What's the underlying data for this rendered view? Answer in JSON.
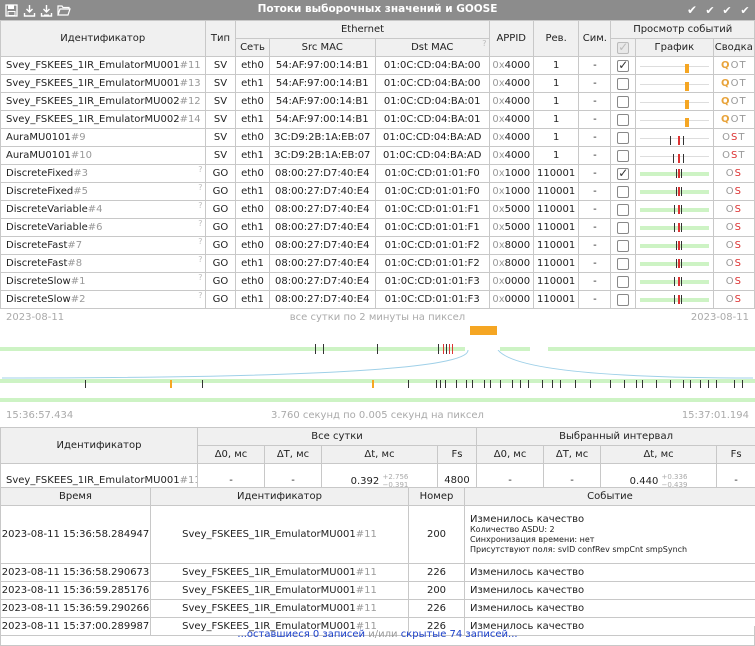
{
  "title": "Потоки выборочных значений и GOOSE",
  "toolbar_icons": [
    "save-icon",
    "download-icon",
    "download-all-icon",
    "folder-open-icon"
  ],
  "header_right_icons": [
    "check-icon",
    "double-check-icon",
    "double-check-all-icon",
    "check-down-icon"
  ],
  "streams": {
    "headers": {
      "id": "Идентификатор",
      "type": "Тип",
      "ethernet": "Ethernet",
      "net": "Сеть",
      "src": "Src MAC",
      "dst": "Dst MAC",
      "appid": "APPID",
      "rev": "Рев.",
      "sim": "Сим.",
      "events": "Просмотр событий",
      "graph": "График",
      "summary": "Сводка"
    },
    "rows": [
      {
        "id": "Svey_FSKEES_1IR_EmulatorMU001",
        "num": "#11",
        "type": "SV",
        "net": "eth0",
        "src": "54:AF:97:00:14:B1",
        "dst": "01:0C:CD:04:BA:00",
        "appid_pre": "0x",
        "appid": "4000",
        "rev": "1",
        "sim": "-",
        "checked": true,
        "sum": [
          "Q",
          "O",
          "T"
        ],
        "sum_colors": [
          "sq",
          "so",
          "st"
        ],
        "track": "none",
        "marks": [
          {
            "p": 0.66,
            "c": "#f5a623",
            "w": 4
          }
        ]
      },
      {
        "id": "Svey_FSKEES_1IR_EmulatorMU001",
        "num": "#13",
        "type": "SV",
        "net": "eth1",
        "src": "54:AF:97:00:14:B1",
        "dst": "01:0C:CD:04:BA:00",
        "appid_pre": "0x",
        "appid": "4000",
        "rev": "1",
        "sim": "-",
        "checked": false,
        "sum": [
          "Q",
          "O",
          "T"
        ],
        "sum_colors": [
          "sq",
          "so",
          "st"
        ],
        "track": "none",
        "marks": [
          {
            "p": 0.66,
            "c": "#f5a623",
            "w": 4
          }
        ]
      },
      {
        "id": "Svey_FSKEES_1IR_EmulatorMU002",
        "num": "#12",
        "type": "SV",
        "net": "eth0",
        "src": "54:AF:97:00:14:B1",
        "dst": "01:0C:CD:04:BA:01",
        "appid_pre": "0x",
        "appid": "4000",
        "rev": "1",
        "sim": "-",
        "checked": false,
        "sum": [
          "Q",
          "O",
          "T"
        ],
        "sum_colors": [
          "sq",
          "so",
          "st"
        ],
        "track": "none",
        "marks": [
          {
            "p": 0.66,
            "c": "#f5a623",
            "w": 4
          }
        ]
      },
      {
        "id": "Svey_FSKEES_1IR_EmulatorMU002",
        "num": "#14",
        "type": "SV",
        "net": "eth1",
        "src": "54:AF:97:00:14:B1",
        "dst": "01:0C:CD:04:BA:01",
        "appid_pre": "0x",
        "appid": "4000",
        "rev": "1",
        "sim": "-",
        "checked": false,
        "sum": [
          "Q",
          "O",
          "T"
        ],
        "sum_colors": [
          "sq",
          "so",
          "st"
        ],
        "track": "none",
        "marks": [
          {
            "p": 0.66,
            "c": "#f5a623",
            "w": 4
          }
        ]
      },
      {
        "id": "AuraMU0101",
        "num": "#9",
        "type": "SV",
        "net": "eth0",
        "src": "3C:D9:2B:1A:EB:07",
        "dst": "01:0C:CD:04:BA:AD",
        "appid_pre": "0x",
        "appid": "4000",
        "rev": "1",
        "sim": "-",
        "checked": false,
        "sum": [
          "O",
          "S",
          "T"
        ],
        "sum_colors": [
          "so",
          "ss",
          "st"
        ],
        "track": "none",
        "marks": [
          {
            "p": 0.44,
            "c": "#333",
            "w": 1
          },
          {
            "p": 0.55,
            "c": "#d33",
            "w": 2
          },
          {
            "p": 0.62,
            "c": "#333",
            "w": 1
          }
        ]
      },
      {
        "id": "AuraMU0101",
        "num": "#10",
        "type": "SV",
        "net": "eth1",
        "src": "3C:D9:2B:1A:EB:07",
        "dst": "01:0C:CD:04:BA:AD",
        "appid_pre": "0x",
        "appid": "4000",
        "rev": "1",
        "sim": "-",
        "checked": false,
        "sum": [
          "O",
          "S",
          "T"
        ],
        "sum_colors": [
          "so",
          "ss",
          "st"
        ],
        "track": "none",
        "marks": [
          {
            "p": 0.48,
            "c": "#333",
            "w": 1
          },
          {
            "p": 0.55,
            "c": "#d33",
            "w": 2
          },
          {
            "p": 0.62,
            "c": "#333",
            "w": 1
          }
        ]
      },
      {
        "id": "DiscreteFixed",
        "num": "#3",
        "type": "GO",
        "net": "eth0",
        "src": "08:00:27:D7:40:E4",
        "dst": "01:0C:CD:01:01:F0",
        "appid_pre": "0x",
        "appid": "1000",
        "rev": "110001",
        "sim": "-",
        "checked": true,
        "sum": [
          "O",
          "S"
        ],
        "sum_colors": [
          "so",
          "ss"
        ],
        "track": "green",
        "marks": [
          {
            "p": 0.52,
            "c": "#333",
            "w": 1
          },
          {
            "p": 0.55,
            "c": "#d33",
            "w": 2
          },
          {
            "p": 0.6,
            "c": "#333",
            "w": 1
          }
        ]
      },
      {
        "id": "DiscreteFixed",
        "num": "#5",
        "type": "GO",
        "net": "eth1",
        "src": "08:00:27:D7:40:E4",
        "dst": "01:0C:CD:01:01:F0",
        "appid_pre": "0x",
        "appid": "1000",
        "rev": "110001",
        "sim": "-",
        "checked": false,
        "sum": [
          "O",
          "S"
        ],
        "sum_colors": [
          "so",
          "ss"
        ],
        "track": "green",
        "marks": [
          {
            "p": 0.52,
            "c": "#333",
            "w": 1
          },
          {
            "p": 0.55,
            "c": "#d33",
            "w": 2
          },
          {
            "p": 0.6,
            "c": "#333",
            "w": 1
          }
        ]
      },
      {
        "id": "DiscreteVariable",
        "num": "#4",
        "type": "GO",
        "net": "eth0",
        "src": "08:00:27:D7:40:E4",
        "dst": "01:0C:CD:01:01:F1",
        "appid_pre": "0x",
        "appid": "5000",
        "rev": "110001",
        "sim": "-",
        "checked": false,
        "sum": [
          "O",
          "S"
        ],
        "sum_colors": [
          "so",
          "ss"
        ],
        "track": "green",
        "marks": [
          {
            "p": 0.5,
            "c": "#333",
            "w": 1
          },
          {
            "p": 0.55,
            "c": "#d33",
            "w": 2
          },
          {
            "p": 0.6,
            "c": "#333",
            "w": 1
          }
        ]
      },
      {
        "id": "DiscreteVariable",
        "num": "#6",
        "type": "GO",
        "net": "eth1",
        "src": "08:00:27:D7:40:E4",
        "dst": "01:0C:CD:01:01:F1",
        "appid_pre": "0x",
        "appid": "5000",
        "rev": "110001",
        "sim": "-",
        "checked": false,
        "sum": [
          "O",
          "S"
        ],
        "sum_colors": [
          "so",
          "ss"
        ],
        "track": "green",
        "marks": [
          {
            "p": 0.5,
            "c": "#333",
            "w": 1
          },
          {
            "p": 0.55,
            "c": "#d33",
            "w": 2
          },
          {
            "p": 0.6,
            "c": "#333",
            "w": 1
          }
        ]
      },
      {
        "id": "DiscreteFast",
        "num": "#7",
        "type": "GO",
        "net": "eth0",
        "src": "08:00:27:D7:40:E4",
        "dst": "01:0C:CD:01:01:F2",
        "appid_pre": "0x",
        "appid": "8000",
        "rev": "110001",
        "sim": "-",
        "checked": false,
        "sum": [
          "O",
          "S"
        ],
        "sum_colors": [
          "so",
          "ss"
        ],
        "track": "green",
        "marks": [
          {
            "p": 0.52,
            "c": "#333",
            "w": 1
          },
          {
            "p": 0.55,
            "c": "#d33",
            "w": 2
          },
          {
            "p": 0.6,
            "c": "#333",
            "w": 1
          }
        ]
      },
      {
        "id": "DiscreteFast",
        "num": "#8",
        "type": "GO",
        "net": "eth1",
        "src": "08:00:27:D7:40:E4",
        "dst": "01:0C:CD:01:01:F2",
        "appid_pre": "0x",
        "appid": "8000",
        "rev": "110001",
        "sim": "-",
        "checked": false,
        "sum": [
          "O",
          "S"
        ],
        "sum_colors": [
          "so",
          "ss"
        ],
        "track": "green",
        "marks": [
          {
            "p": 0.52,
            "c": "#333",
            "w": 1
          },
          {
            "p": 0.55,
            "c": "#d33",
            "w": 2
          },
          {
            "p": 0.6,
            "c": "#333",
            "w": 1
          }
        ]
      },
      {
        "id": "DiscreteSlow",
        "num": "#1",
        "type": "GO",
        "net": "eth0",
        "src": "08:00:27:D7:40:E4",
        "dst": "01:0C:CD:01:01:F3",
        "appid_pre": "0x",
        "appid": "0000",
        "rev": "110001",
        "sim": "-",
        "checked": false,
        "sum": [
          "O",
          "S"
        ],
        "sum_colors": [
          "so",
          "ss"
        ],
        "track": "green",
        "marks": [
          {
            "p": 0.5,
            "c": "#333",
            "w": 1
          },
          {
            "p": 0.55,
            "c": "#d33",
            "w": 2
          },
          {
            "p": 0.6,
            "c": "#333",
            "w": 1
          }
        ]
      },
      {
        "id": "DiscreteSlow",
        "num": "#2",
        "type": "GO",
        "net": "eth1",
        "src": "08:00:27:D7:40:E4",
        "dst": "01:0C:CD:01:01:F3",
        "appid_pre": "0x",
        "appid": "0000",
        "rev": "110001",
        "sim": "-",
        "checked": false,
        "sum": [
          "O",
          "S"
        ],
        "sum_colors": [
          "so",
          "ss"
        ],
        "track": "green",
        "marks": [
          {
            "p": 0.5,
            "c": "#333",
            "w": 1
          },
          {
            "p": 0.55,
            "c": "#d33",
            "w": 2
          },
          {
            "p": 0.6,
            "c": "#333",
            "w": 1
          }
        ]
      }
    ]
  },
  "timeline": {
    "day_left": "2023-08-11",
    "day_center": "все сутки по 2 минуты на пиксел",
    "day_right": "2023-08-11",
    "sel_left": "15:36:57.434",
    "sel_center": "3.760 секунд по 0.005 секунд на пиксел",
    "sel_right": "15:37:01.194"
  },
  "stats": {
    "h_id": "Идентификатор",
    "h_all": "Все сутки",
    "h_sel": "Выбранный интервал",
    "h_d0": "Δ0, мс",
    "h_dT": "ΔT, мс",
    "h_dt": "Δt, мс",
    "h_fs": "Fs",
    "id": "Svey_FSKEES_1IR_EmulatorMU001",
    "num": "#11",
    "all_d0": "-",
    "all_dT": "-",
    "all_dt": "0.392",
    "all_dt_plus": "+2.756",
    "all_dt_minus": "−0.391",
    "all_fs": "4800",
    "sel_d0": "-",
    "sel_dT": "-",
    "sel_dt": "0.440",
    "sel_dt_plus": "+0.336",
    "sel_dt_minus": "−0.439",
    "sel_fs": "-"
  },
  "events": {
    "h_time": "Время",
    "h_id": "Идентификатор",
    "h_num": "Номер",
    "h_event": "Событие",
    "rows": [
      {
        "time": "2023-08-11 15:36:58.284947",
        "id": "Svey_FSKEES_1IR_EmulatorMU001",
        "num": "#11",
        "n": "200",
        "event": "Изменилось качество",
        "details": [
          "Количество ASDU: 2",
          "Синхронизация времени: нет",
          "Присутствуют поля: svID confRev smpCnt smpSynch"
        ]
      },
      {
        "time": "2023-08-11 15:36:58.290673",
        "id": "Svey_FSKEES_1IR_EmulatorMU001",
        "num": "#11",
        "n": "226",
        "event": "Изменилось качество",
        "details": []
      },
      {
        "time": "2023-08-11 15:36:59.285176",
        "id": "Svey_FSKEES_1IR_EmulatorMU001",
        "num": "#11",
        "n": "200",
        "event": "Изменилось качество",
        "details": []
      },
      {
        "time": "2023-08-11 15:36:59.290266",
        "id": "Svey_FSKEES_1IR_EmulatorMU001",
        "num": "#11",
        "n": "226",
        "event": "Изменилось качество",
        "details": []
      },
      {
        "time": "2023-08-11 15:37:00.289987",
        "id": "Svey_FSKEES_1IR_EmulatorMU001",
        "num": "#11",
        "n": "226",
        "event": "Изменилось качество",
        "details": []
      }
    ]
  },
  "footer": {
    "remaining": "...оставшиеся 0 записей",
    "sep": " и/или ",
    "hidden": "скрытые 74 записей..."
  }
}
